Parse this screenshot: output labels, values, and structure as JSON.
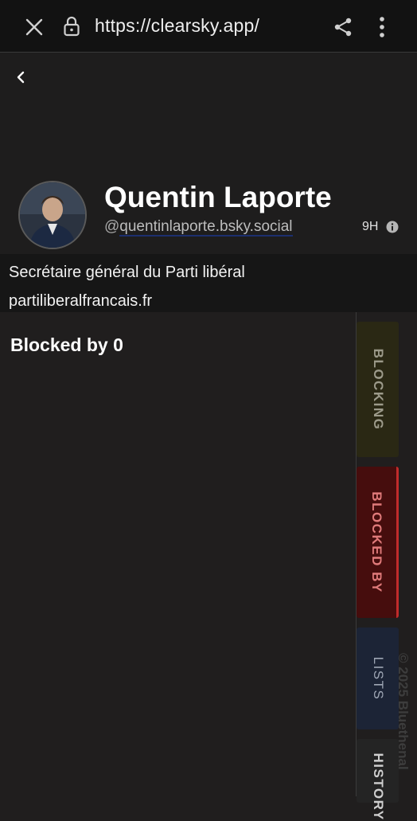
{
  "browser": {
    "url": "https://clearsky.app/"
  },
  "profile": {
    "display_name": "Quentin Laporte",
    "handle_prefix": "@",
    "handle": "quentinlaporte.bsky.social",
    "time_ago": "9H",
    "bio": "Secrétaire général du Parti libéral",
    "link": "partiliberalfrancais.fr"
  },
  "main": {
    "section_title": "Blocked by 0"
  },
  "tabs": [
    {
      "label": "BLOCKING",
      "active": false
    },
    {
      "label": "BLOCKED BY",
      "active": true
    },
    {
      "label": "LISTS",
      "active": false
    },
    {
      "label": "HISTORY",
      "active": false
    }
  ],
  "footer": {
    "copyright": "© 2025 Bluethenal"
  },
  "colors": {
    "background": "#201e1e",
    "browser_bar": "#121212",
    "blocking_tab": "#2a2814",
    "blocked_by_tab": "#460d0d",
    "blocked_by_accent": "#c12b2b",
    "lists_tab": "#1c2436"
  },
  "icons": {
    "back": "chevron-left-icon",
    "close": "close-icon",
    "lock": "lock-icon",
    "share": "share-icon",
    "menu": "more-vertical-icon",
    "info": "info-icon"
  }
}
